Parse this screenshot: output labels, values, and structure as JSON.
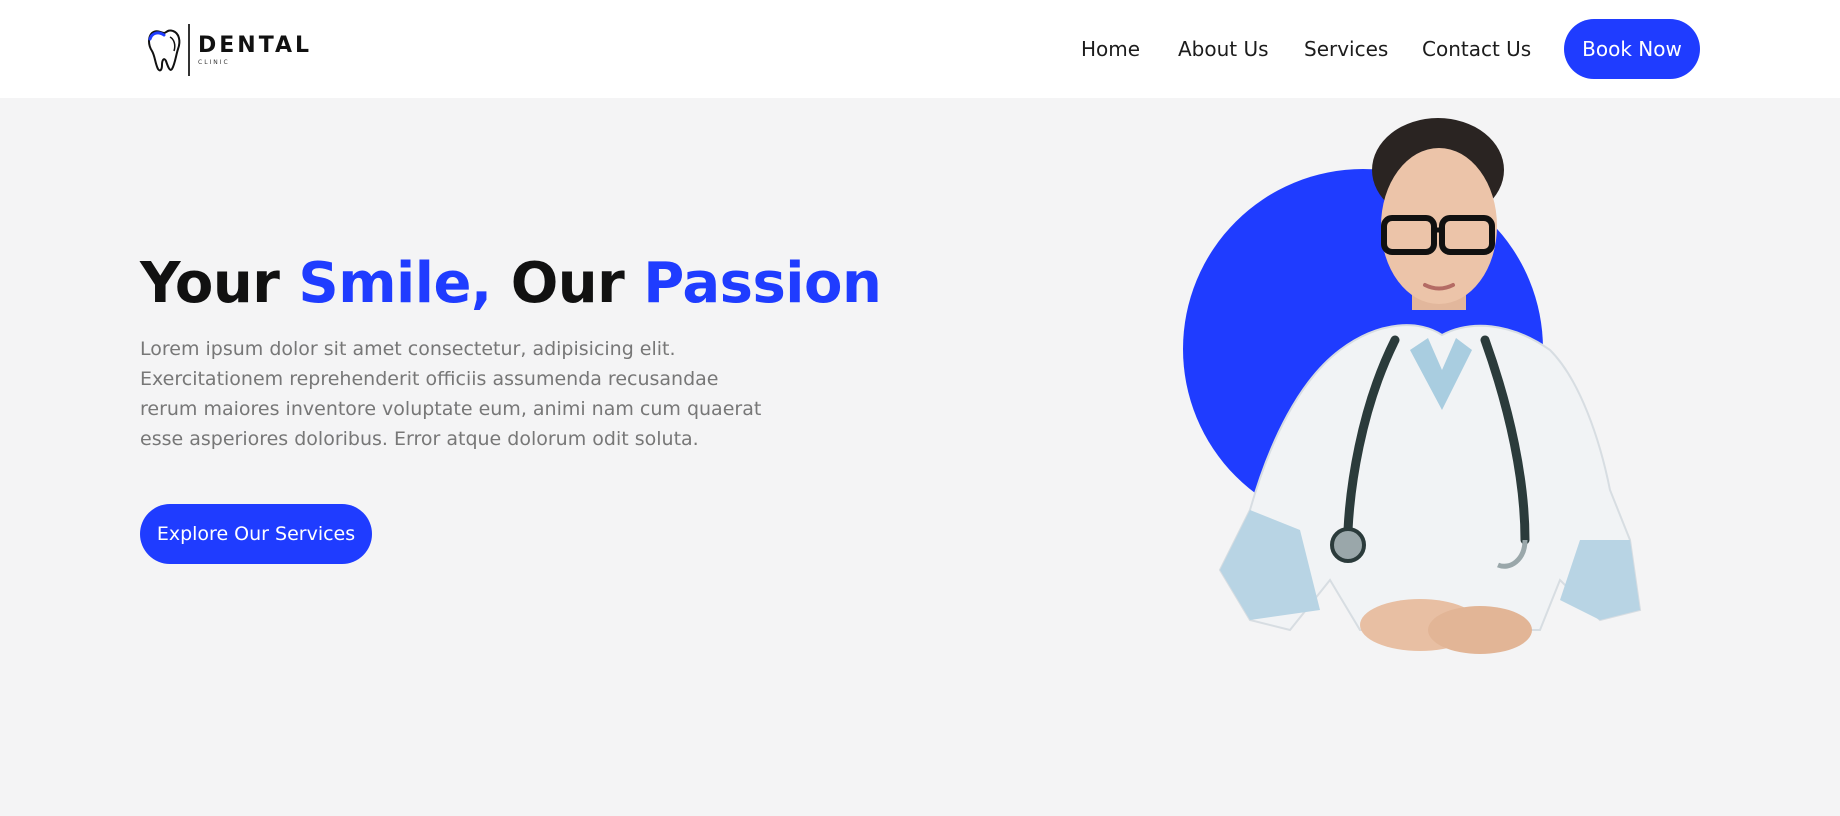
{
  "header": {
    "logo": {
      "main": "DENTAL",
      "sub": "CLINIC"
    },
    "nav": [
      {
        "label": "Home"
      },
      {
        "label": "About Us"
      },
      {
        "label": "Services"
      },
      {
        "label": "Contact Us"
      }
    ],
    "cta_label": "Book Now"
  },
  "hero": {
    "title": {
      "part1": "Your ",
      "part2": "Smile,",
      "part3": " Our ",
      "part4": "Passion"
    },
    "paragraph": "Lorem ipsum dolor sit amet consectetur, adipisicing elit. Exercitationem reprehenderit officiis assumenda recusandae rerum maiores inventore voluptate eum, animi nam cum quaerat esse asperiores doloribus. Error atque dolorum odit soluta.",
    "cta_label": "Explore Our Services"
  },
  "colors": {
    "accent": "#1f3cff",
    "background": "#f4f4f5",
    "header_bg": "#ffffff",
    "heading": "#111111",
    "body_text": "#777777"
  },
  "icons": {
    "logo": "tooth-icon"
  }
}
